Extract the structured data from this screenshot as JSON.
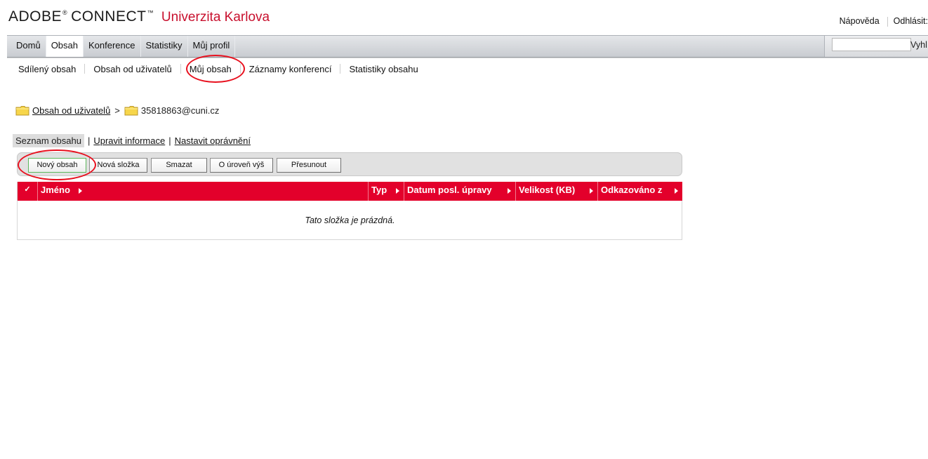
{
  "header": {
    "brand_adobe": "ADOBE",
    "brand_connect": "CONNECT",
    "brand_univ": "Univerzita Karlova",
    "help_link": "Nápověda",
    "logout_link": "Odhlásit:"
  },
  "nav": {
    "tabs": [
      {
        "label": "Domů"
      },
      {
        "label": "Obsah"
      },
      {
        "label": "Konference"
      },
      {
        "label": "Statistiky"
      },
      {
        "label": "Můj profil"
      }
    ],
    "active_tab": "Obsah",
    "search": {
      "value": "",
      "label": "Vyhl"
    }
  },
  "subnav": {
    "items": [
      {
        "label": "Sdílený obsah"
      },
      {
        "label": "Obsah od uživatelů"
      },
      {
        "label": "Můj obsah"
      },
      {
        "label": "Záznamy konferencí"
      },
      {
        "label": "Statistiky obsahu"
      }
    ]
  },
  "breadcrumb": {
    "parent": "Obsah od uživatelů",
    "separator": ">",
    "current": "35818863@cuni.cz"
  },
  "content_tabs": {
    "current": "Seznam obsahu",
    "edit_info": "Upravit informace",
    "set_permissions": "Nastavit oprávnění"
  },
  "toolbar": {
    "new_content": "Nový obsah",
    "new_folder": "Nová složka",
    "delete": "Smazat",
    "up_level": "O úroveň výš",
    "move": "Přesunout"
  },
  "table": {
    "check_glyph": "✓",
    "columns": [
      {
        "label": "Jméno"
      },
      {
        "label": "Typ"
      },
      {
        "label": "Datum posl. úpravy"
      },
      {
        "label": "Velikost (KB)"
      },
      {
        "label": "Odkazováno z"
      }
    ],
    "empty_message": "Tato složka je prázdná."
  },
  "colors": {
    "accent_red": "#e3002b",
    "brand_red": "#c8102e",
    "annotation_red": "#e8101e"
  }
}
